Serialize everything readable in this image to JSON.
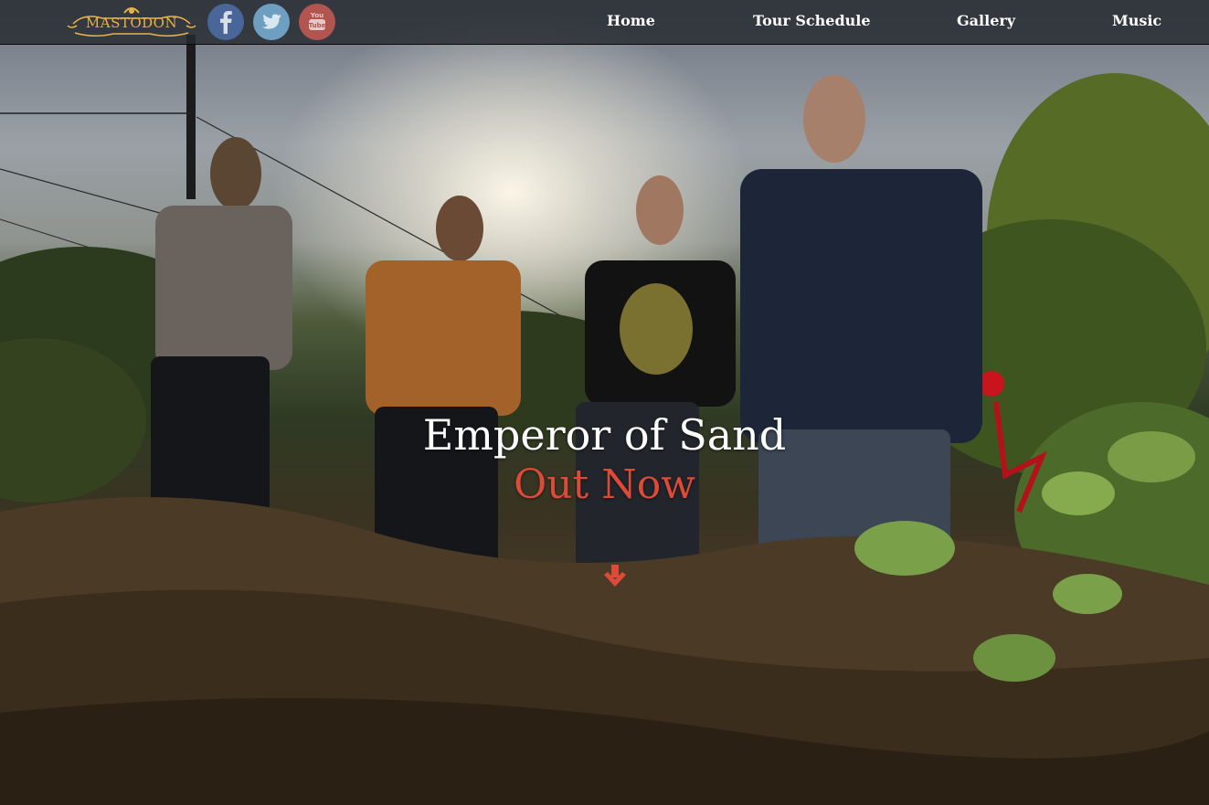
{
  "brand": {
    "logo_text": "MASTODON",
    "logo_color": "#e6b24a"
  },
  "social": [
    {
      "name": "Facebook",
      "icon": "facebook-icon",
      "color": "#4a6597"
    },
    {
      "name": "Twitter",
      "icon": "twitter-icon",
      "color": "#6e9fc1"
    },
    {
      "name": "YouTube",
      "icon": "youtube-icon",
      "color": "#b25450"
    }
  ],
  "nav": {
    "items": [
      {
        "label": "Home"
      },
      {
        "label": "Tour Schedule"
      },
      {
        "label": "Gallery"
      },
      {
        "label": "Music"
      }
    ]
  },
  "hero": {
    "title": "Emperor of Sand",
    "subtitle": "Out Now",
    "subtitle_color": "#dd4a38",
    "scroll_icon": "arrow-down-icon"
  }
}
